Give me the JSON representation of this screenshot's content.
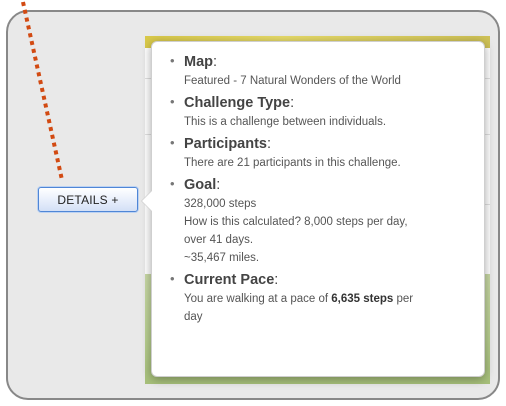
{
  "details_button": {
    "label": "DETAILS +"
  },
  "popover": {
    "sections": [
      {
        "label": "Map",
        "lines": [
          "Featured - 7 Natural Wonders of the World"
        ]
      },
      {
        "label": "Challenge Type",
        "lines": [
          "This is a challenge between individuals."
        ]
      },
      {
        "label": "Participants",
        "lines": [
          "There are 21 participants in this challenge."
        ]
      },
      {
        "label": "Goal",
        "lines": [
          "328,000 steps",
          "How is this calculated? 8,000 steps per day,",
          "over 41 days.",
          "~35,467 miles."
        ]
      },
      {
        "label": "Current Pace",
        "pace_prefix": "You are walking at a pace of ",
        "pace_value": "6,635 steps",
        "pace_suffix": " per",
        "pace_last": "day"
      }
    ]
  },
  "colors": {
    "button_border": "#4f86d6",
    "dotted_line": "#d24a12",
    "frame_border": "#888888"
  }
}
